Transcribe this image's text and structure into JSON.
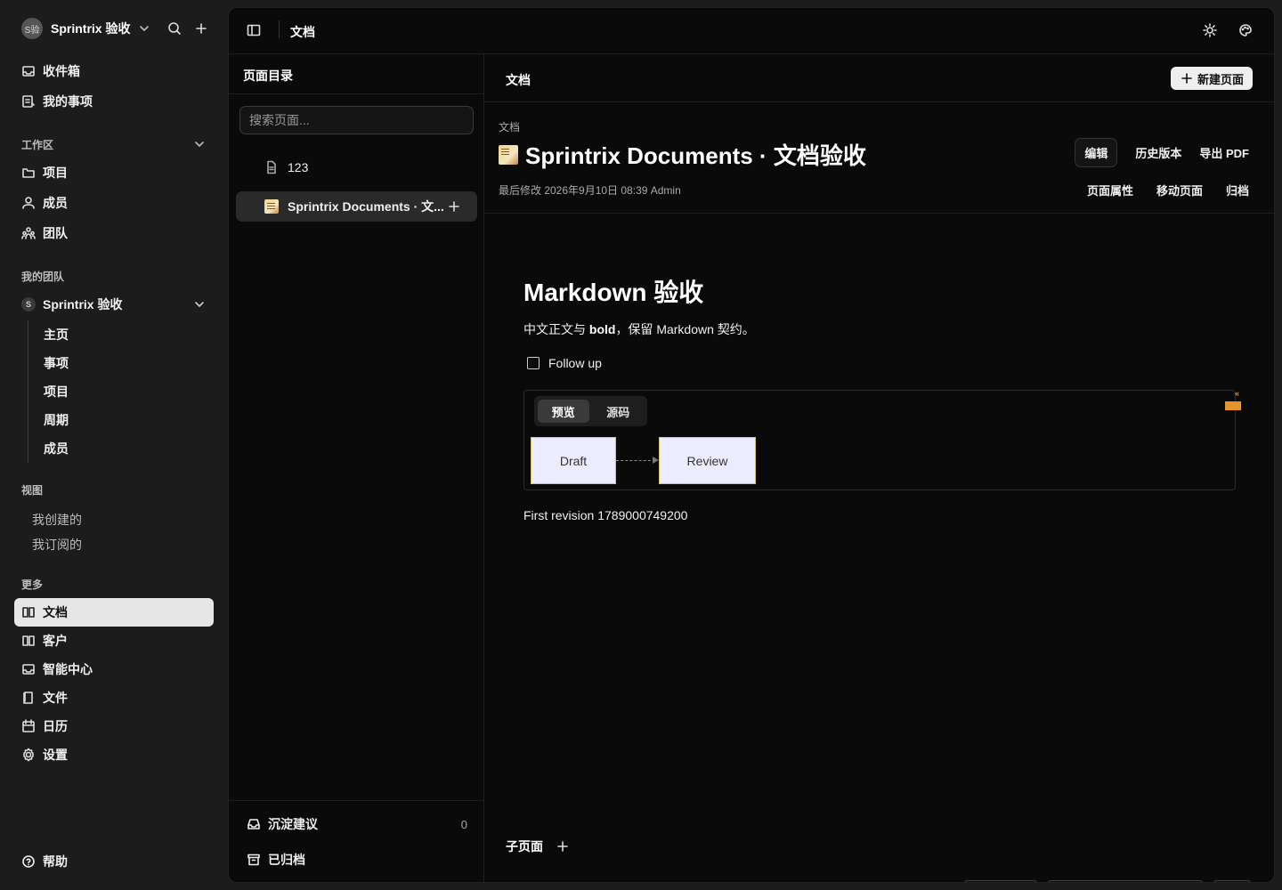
{
  "workspace": {
    "avatar": "S验",
    "name": "Sprintrix 验收"
  },
  "sidebar": {
    "top_items": [
      {
        "label": "收件箱",
        "icon": "inbox-icon"
      },
      {
        "label": "我的事项",
        "icon": "tasks-icon"
      }
    ],
    "workspace_section": "工作区",
    "workspace_items": [
      {
        "label": "项目",
        "icon": "folder-icon"
      },
      {
        "label": "成员",
        "icon": "user-icon"
      },
      {
        "label": "团队",
        "icon": "team-icon"
      }
    ],
    "my_teams_section": "我的团队",
    "team": {
      "dot": "S",
      "name": "Sprintrix 验收"
    },
    "team_items": [
      "主页",
      "事项",
      "项目",
      "周期",
      "成员"
    ],
    "views_section": "视图",
    "view_items": [
      "我创建的",
      "我订阅的"
    ],
    "more_section": "更多",
    "more_items": [
      {
        "label": "文档",
        "icon": "book-icon",
        "active": true
      },
      {
        "label": "客户",
        "icon": "book-icon"
      },
      {
        "label": "智能中心",
        "icon": "inbox-icon"
      },
      {
        "label": "文件",
        "icon": "file-icon"
      },
      {
        "label": "日历",
        "icon": "calendar-icon"
      },
      {
        "label": "设置",
        "icon": "gear-icon"
      }
    ],
    "help": "帮助"
  },
  "topbar": {
    "title": "文档"
  },
  "directory": {
    "heading": "页面目录",
    "search_placeholder": "搜索页面...",
    "pages": [
      {
        "title": "123",
        "icon": "document-icon"
      },
      {
        "title": "Sprintrix Documents · 文...",
        "icon": "memo-emoji",
        "active": true
      }
    ],
    "footer": [
      {
        "label": "沉淀建议",
        "count": "0",
        "icon": "tray-icon"
      },
      {
        "label": "已归档",
        "icon": "archive-icon"
      }
    ]
  },
  "document": {
    "header_label": "文档",
    "new_page_label": "新建页面",
    "breadcrumb": "文档",
    "title": "Sprintrix Documents · 文档验收",
    "meta": "最后修改 2026年9月10日 08:39 Admin",
    "actions_top": [
      "编辑",
      "历史版本",
      "导出 PDF"
    ],
    "actions_bottom": [
      "页面属性",
      "移动页面",
      "归档"
    ],
    "content": {
      "heading": "Markdown 验收",
      "para_prefix": "中文正文与 ",
      "para_bold": "bold",
      "para_suffix": "，保留 Markdown 契约。",
      "todo_label": "Follow up",
      "todo_checked": false,
      "diagram_tabs": [
        "预览",
        "源码"
      ],
      "diagram_nodes": [
        "Draft",
        "Review"
      ],
      "diagram_marker": "«",
      "revision": "First revision 1789000749200"
    },
    "children_label": "子页面"
  },
  "colors": {
    "accent_marker": "#e7922b",
    "node_fill": "#ececfe",
    "node_border": "#d6c36e"
  }
}
